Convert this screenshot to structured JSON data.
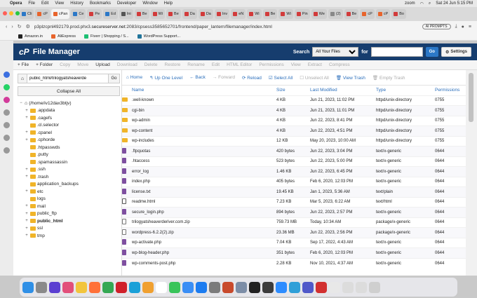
{
  "menubar": {
    "app": "Opera",
    "items": [
      "File",
      "Edit",
      "View",
      "History",
      "Bookmarks",
      "Developer",
      "Window",
      "Help"
    ],
    "zoom_label": "zoom",
    "datetime": "Sat 24 Jun  5:15 PM"
  },
  "tabs": [
    {
      "label": "Cli",
      "color": "#2c78c7"
    },
    {
      "label": "cP",
      "color": "#e8642c"
    },
    {
      "label": "cPan",
      "color": "#e8642c",
      "active": true
    },
    {
      "label": "Ce",
      "color": "#2c78c7"
    },
    {
      "label": "Pe",
      "color": "#d23b3b"
    },
    {
      "label": "Ed",
      "color": "#2c78c7"
    },
    {
      "label": "Ini",
      "color": "#555"
    },
    {
      "label": "Be",
      "color": "#d23b3b"
    },
    {
      "label": "Wi",
      "color": "#d23b3b"
    },
    {
      "label": "Be",
      "color": "#d23b3b"
    },
    {
      "label": "Da",
      "color": "#d23b3b"
    },
    {
      "label": "Da",
      "color": "#d23b3b"
    },
    {
      "label": "Inv",
      "color": "#d23b3b"
    },
    {
      "label": "eN",
      "color": "#d23b3b"
    },
    {
      "label": "Wi",
      "color": "#d23b3b"
    },
    {
      "label": "Be",
      "color": "#d23b3b"
    },
    {
      "label": "Wi",
      "color": "#d23b3b"
    },
    {
      "label": "Pin",
      "color": "#d23b3b"
    },
    {
      "label": "We",
      "color": "#d23b3b"
    },
    {
      "label": "(2)",
      "color": "#888"
    },
    {
      "label": "Be",
      "color": "#d23b3b"
    },
    {
      "label": "cP",
      "color": "#e8642c"
    },
    {
      "label": "cP",
      "color": "#e8642c"
    },
    {
      "label": "Bo",
      "color": "#d23b3b"
    }
  ],
  "address": {
    "url_prefix": "p3plzcpnl492179.prod.phx3.",
    "url_host": "secureserver.net",
    "url_suffix": ":2083/cpsess3585652701/frontend/paper_lantern/filemanager/index.html",
    "ai_prompts": "AI PROMPTS"
  },
  "bookmarks": [
    {
      "label": "Amazon.in",
      "color": "#222"
    },
    {
      "label": "AliExpress",
      "color": "#e8642c"
    },
    {
      "label": "Fiverr | Shopping / S...",
      "color": "#1dbf73"
    },
    {
      "label": "WordPress Support...",
      "color": "#21759b"
    }
  ],
  "header": {
    "logo_mark": "cP",
    "title": "File Manager",
    "search_label": "Search",
    "search_scope": "All Your Files",
    "for_label": "for",
    "search_value": "",
    "go_label": "Go",
    "settings_label": "Settings"
  },
  "toolbar": [
    {
      "name": "file",
      "label": "+ File",
      "enabled": true
    },
    {
      "name": "folder",
      "label": "+ Folder",
      "enabled": true
    },
    {
      "name": "copy",
      "label": "Copy",
      "enabled": false
    },
    {
      "name": "move",
      "label": "Move",
      "enabled": false
    },
    {
      "name": "upload",
      "label": "Upload",
      "enabled": true
    },
    {
      "name": "download",
      "label": "Download",
      "enabled": false
    },
    {
      "name": "delete",
      "label": "Delete",
      "enabled": false
    },
    {
      "name": "restore",
      "label": "Restore",
      "enabled": false
    },
    {
      "name": "rename",
      "label": "Rename",
      "enabled": false
    },
    {
      "name": "edit",
      "label": "Edit",
      "enabled": false
    },
    {
      "name": "html-editor",
      "label": "HTML Editor",
      "enabled": false
    },
    {
      "name": "permissions",
      "label": "Permissions",
      "enabled": false
    },
    {
      "name": "view",
      "label": "View",
      "enabled": false
    },
    {
      "name": "extract",
      "label": "Extract",
      "enabled": false
    },
    {
      "name": "compress",
      "label": "Compress",
      "enabled": false
    }
  ],
  "leftpane": {
    "path_value": "public_html/trilogyatsheaverde",
    "go_label": "Go",
    "collapse_label": "Collapse All",
    "tree": [
      {
        "label": "(/home/iv12dax3btjv)",
        "toggle": "−",
        "indent": 0,
        "open": true,
        "home": true
      },
      {
        "label": ".appdata",
        "toggle": "+",
        "indent": 1
      },
      {
        "label": ".cagefs",
        "toggle": "+",
        "indent": 1
      },
      {
        "label": ".cl.selector",
        "toggle": "",
        "indent": 1
      },
      {
        "label": ".cpanel",
        "toggle": "+",
        "indent": 1
      },
      {
        "label": ".cphorde",
        "toggle": "+",
        "indent": 1
      },
      {
        "label": ".htpasswds",
        "toggle": "",
        "indent": 1
      },
      {
        "label": ".putty",
        "toggle": "",
        "indent": 1
      },
      {
        "label": ".spamassassin",
        "toggle": "",
        "indent": 1
      },
      {
        "label": ".ssh",
        "toggle": "+",
        "indent": 1
      },
      {
        "label": ".trash",
        "toggle": "+",
        "indent": 1
      },
      {
        "label": "application_backups",
        "toggle": "",
        "indent": 1
      },
      {
        "label": "etc",
        "toggle": "+",
        "indent": 1
      },
      {
        "label": "logs",
        "toggle": "",
        "indent": 1
      },
      {
        "label": "mail",
        "toggle": "+",
        "indent": 1
      },
      {
        "label": "public_ftp",
        "toggle": "+",
        "indent": 1
      },
      {
        "label": "public_html",
        "toggle": "+",
        "indent": 1,
        "bold": true
      },
      {
        "label": "ssl",
        "toggle": "+",
        "indent": 1
      },
      {
        "label": "tmp",
        "toggle": "+",
        "indent": 1
      }
    ]
  },
  "actionbar": [
    {
      "name": "home",
      "label": "⌂ Home",
      "enabled": true
    },
    {
      "name": "up-one-level",
      "label": "↰ Up One Level",
      "enabled": true
    },
    {
      "name": "back",
      "label": "← Back",
      "enabled": true
    },
    {
      "name": "forward",
      "label": "→ Forward",
      "enabled": false
    },
    {
      "name": "reload",
      "label": "⟳ Reload",
      "enabled": true
    },
    {
      "name": "select-all",
      "label": "☑ Select All",
      "enabled": true
    },
    {
      "name": "unselect-all",
      "label": "☐ Unselect All",
      "enabled": false
    },
    {
      "name": "view-trash",
      "label": "🗑 View Trash",
      "enabled": true
    },
    {
      "name": "empty-trash",
      "label": "🗑 Empty Trash",
      "enabled": false
    }
  ],
  "columns": [
    "Name",
    "Size",
    "Last Modified",
    "Type",
    "Permissions"
  ],
  "files": [
    {
      "icon": "folder",
      "name": ".well-known",
      "size": "4 KB",
      "modified": "Jun 21, 2023, 11:02 PM",
      "type": "httpd/unix-directory",
      "perms": "0755"
    },
    {
      "icon": "folder",
      "name": "cgi-bin",
      "size": "4 KB",
      "modified": "Jun 21, 2023, 11:01 PM",
      "type": "httpd/unix-directory",
      "perms": "0755"
    },
    {
      "icon": "folder",
      "name": "wp-admin",
      "size": "4 KB",
      "modified": "Jun 22, 2023, 8:41 PM",
      "type": "httpd/unix-directory",
      "perms": "0755"
    },
    {
      "icon": "folder",
      "name": "wp-content",
      "size": "4 KB",
      "modified": "Jun 22, 2023, 4:51 PM",
      "type": "httpd/unix-directory",
      "perms": "0755"
    },
    {
      "icon": "folder",
      "name": "wp-includes",
      "size": "12 KB",
      "modified": "May 20, 2023, 10:00 AM",
      "type": "httpd/unix-directory",
      "perms": "0755"
    },
    {
      "icon": "file",
      "name": ".ftpquotas",
      "size": "420 bytes",
      "modified": "Jun 22, 2023, 3:04 PM",
      "type": "text/x-generic",
      "perms": "0644"
    },
    {
      "icon": "file",
      "name": ".htaccess",
      "size": "523 bytes",
      "modified": "Jun 22, 2023, 5:00 PM",
      "type": "text/x-generic",
      "perms": "0644"
    },
    {
      "icon": "file",
      "name": "error_log",
      "size": "1.46 KB",
      "modified": "Jun 22, 2023, 6:45 PM",
      "type": "text/x-generic",
      "perms": "0644"
    },
    {
      "icon": "file",
      "name": "index.php",
      "size": "405 bytes",
      "modified": "Feb 6, 2020, 12:03 PM",
      "type": "text/x-generic",
      "perms": "0644"
    },
    {
      "icon": "file",
      "name": "license.txt",
      "size": "19.45 KB",
      "modified": "Jan 1, 2023, 5:36 AM",
      "type": "text/plain",
      "perms": "0644"
    },
    {
      "icon": "doc",
      "name": "readme.html",
      "size": "7.23 KB",
      "modified": "Mar 5, 2023, 6:22 AM",
      "type": "text/html",
      "perms": "0644"
    },
    {
      "icon": "file",
      "name": "secure_login.php",
      "size": "894 bytes",
      "modified": "Jun 22, 2023, 2:57 PM",
      "type": "text/x-generic",
      "perms": "0644"
    },
    {
      "icon": "zip",
      "name": "trilogyatsheaverderiver.com.zip",
      "size": "759.73 MB",
      "modified": "Today, 10:34 AM",
      "type": "package/x-generic",
      "perms": "0644"
    },
    {
      "icon": "zip",
      "name": "wordpress-6.2.2(2).zip",
      "size": "23.36 MB",
      "modified": "Jun 22, 2023, 2:56 PM",
      "type": "package/x-generic",
      "perms": "0644"
    },
    {
      "icon": "file",
      "name": "wp-activate.php",
      "size": "7.04 KB",
      "modified": "Sep 17, 2022, 4:43 AM",
      "type": "text/x-generic",
      "perms": "0644"
    },
    {
      "icon": "file",
      "name": "wp-blog-header.php",
      "size": "351 bytes",
      "modified": "Feb 6, 2020, 12:03 PM",
      "type": "text/x-generic",
      "perms": "0644"
    },
    {
      "icon": "file",
      "name": "wp-comments-post.php",
      "size": "2.28 KB",
      "modified": "Nov 10, 2021, 4:37 AM",
      "type": "text/x-generic",
      "perms": "0644"
    }
  ],
  "dock": [
    {
      "name": "finder",
      "color": "#2f8fe6"
    },
    {
      "name": "launchpad",
      "color": "#8a8a8a"
    },
    {
      "name": "siri",
      "color": "#5b3fd1"
    },
    {
      "name": "app-grid",
      "color": "#e24f7a"
    },
    {
      "name": "notes",
      "color": "#f2c53d"
    },
    {
      "name": "firefox",
      "color": "#ff7139"
    },
    {
      "name": "chrome",
      "color": "#34a853"
    },
    {
      "name": "opera",
      "color": "#d0202a"
    },
    {
      "name": "edge",
      "color": "#1aa0d8"
    },
    {
      "name": "photos",
      "color": "#f0a030"
    },
    {
      "name": "calendar",
      "color": "#ffffff"
    },
    {
      "name": "messages",
      "color": "#39c45a"
    },
    {
      "name": "mail",
      "color": "#3a8ef5"
    },
    {
      "name": "app-store",
      "color": "#1c7cf0"
    },
    {
      "name": "system-settings",
      "color": "#7b7b7b"
    },
    {
      "name": "app-1",
      "color": "#c84a2c"
    },
    {
      "name": "preview",
      "color": "#7c8da6"
    },
    {
      "name": "terminal",
      "color": "#222222"
    },
    {
      "name": "quicktime",
      "color": "#3c3c3c"
    },
    {
      "name": "zoom",
      "color": "#2d8cff"
    },
    {
      "name": "app-2",
      "color": "#2f9fd8"
    },
    {
      "name": "teams",
      "color": "#5059c9"
    },
    {
      "name": "app-3",
      "color": "#d23030"
    },
    {
      "name": "downloads",
      "color": "#e8e8e8"
    },
    {
      "name": "window-1",
      "color": "#dcdcdc"
    },
    {
      "name": "window-2",
      "color": "#dcdcdc"
    },
    {
      "name": "trash",
      "color": "#cfcfcf"
    }
  ]
}
